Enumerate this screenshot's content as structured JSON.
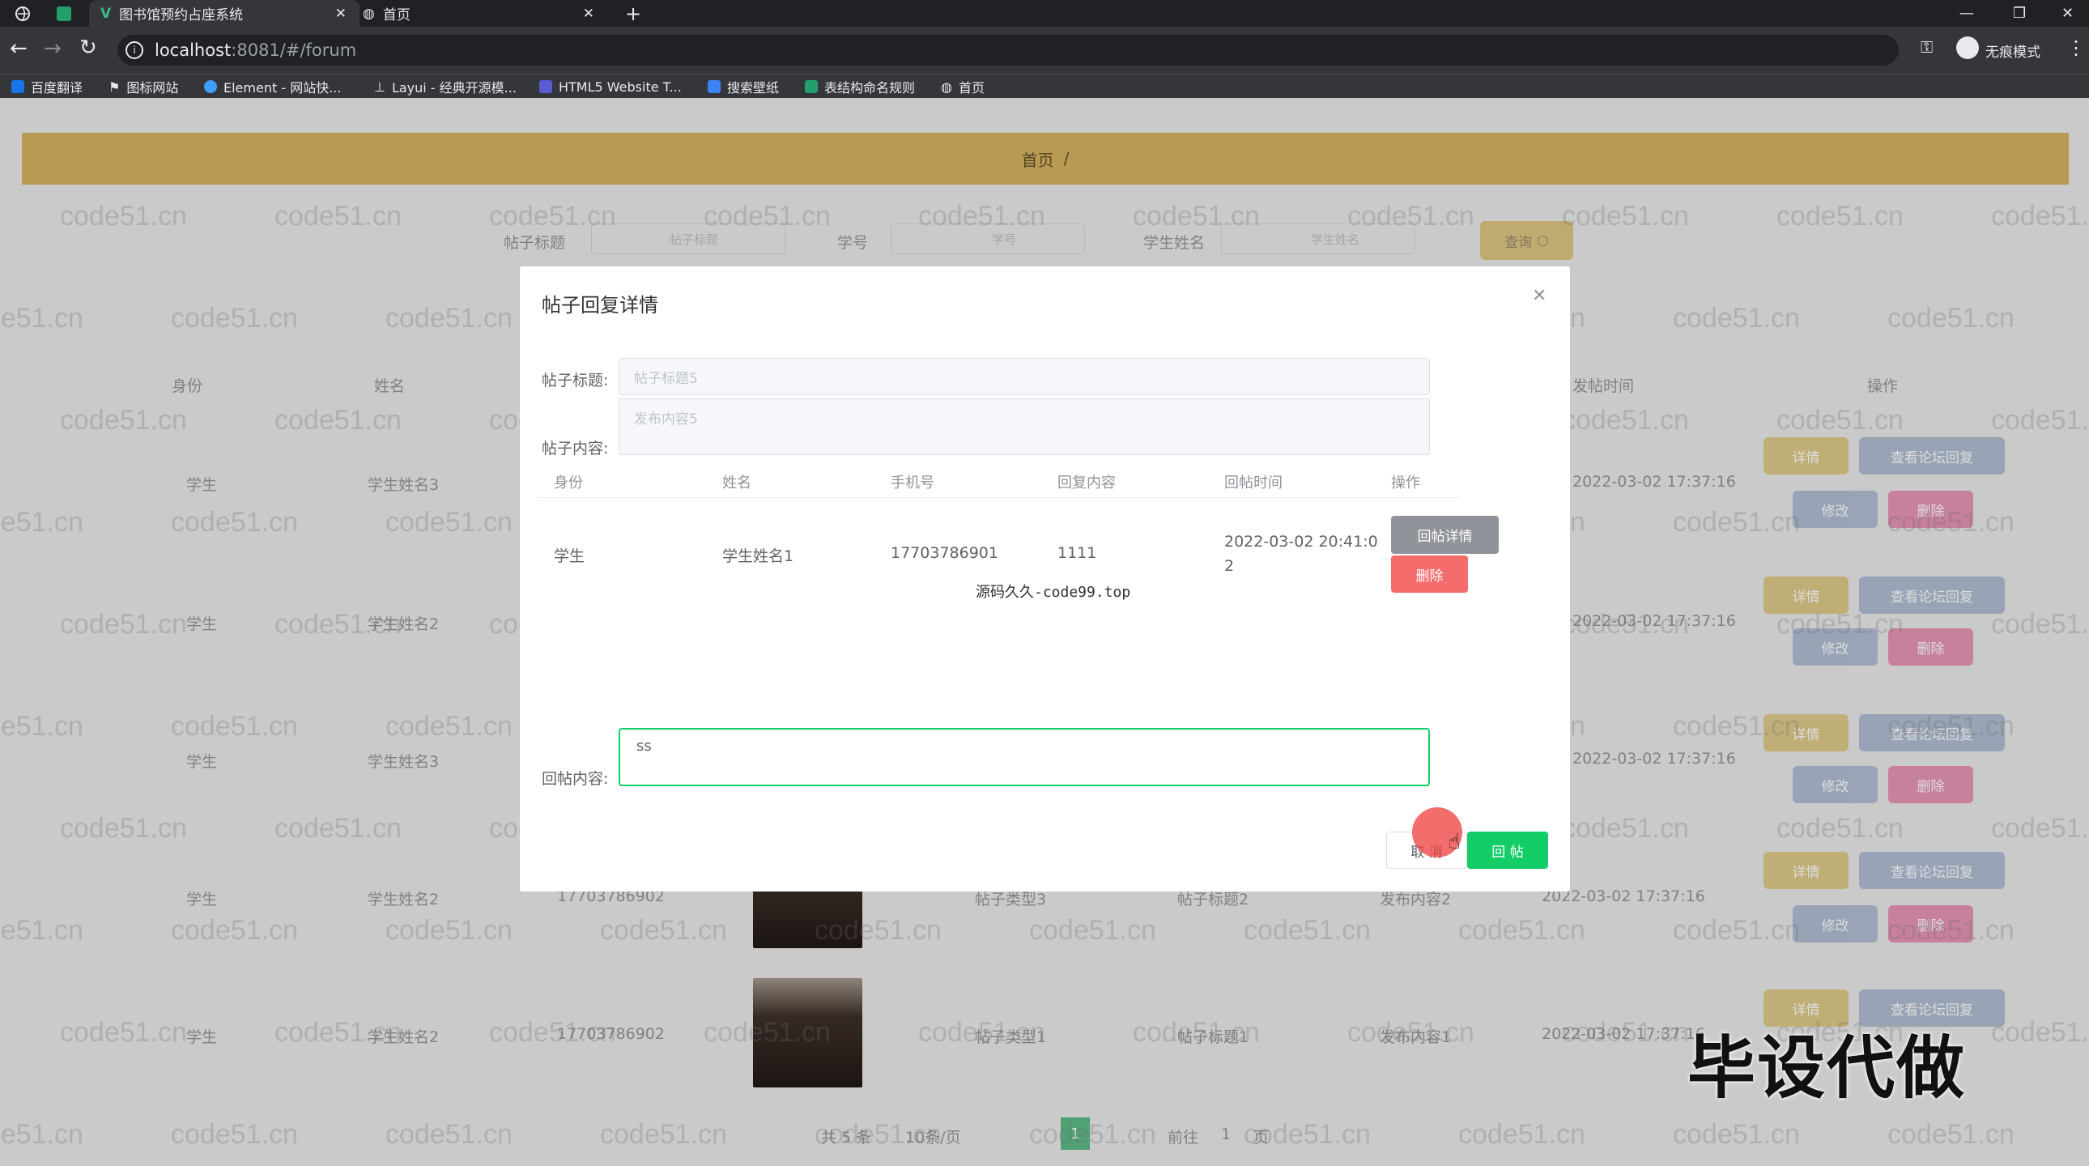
{
  "browser": {
    "tabs": [
      {
        "label": "图书馆预约占座系统"
      },
      {
        "label": "首页"
      }
    ],
    "url_host": "localhost",
    "url_rest": ":8081/#/forum",
    "profile_label": "无痕模式",
    "bookmarks": [
      {
        "label": "百度翻译",
        "color": "#1a73e8"
      },
      {
        "label": "图标网站",
        "color": "#e8eaed"
      },
      {
        "label": "Element - 网站快...",
        "color": "#409eff"
      },
      {
        "label": "Layui - 经典开源模...",
        "color": "#e8eaed"
      },
      {
        "label": "HTML5 Website T...",
        "color": "#5b5bd6"
      },
      {
        "label": "搜索壁纸",
        "color": "#3b82f6"
      },
      {
        "label": "表结构命名规则",
        "color": "#22a06b"
      },
      {
        "label": "首页",
        "color": "#e8eaed"
      }
    ]
  },
  "page": {
    "breadcrumb_home": "首页",
    "breadcrumb_sep": "/",
    "search": {
      "title_label": "帖子标题",
      "title_placeholder": "帖子标题",
      "id_label": "学号",
      "id_placeholder": "学号",
      "name_label": "学生姓名",
      "name_placeholder": "学生姓名",
      "query_button": "查询"
    },
    "columns": {
      "identity": "身份",
      "name": "姓名",
      "post_time": "发帖时间",
      "actions": "操作"
    },
    "rows": [
      {
        "identity": "学生",
        "name": "学生姓名3",
        "time": "2022-03-02 17:37:16"
      },
      {
        "identity": "学生",
        "name": "学生姓名2",
        "time": "2022-03-02 17:37:16"
      },
      {
        "identity": "学生",
        "name": "学生姓名3",
        "time": "2022-03-02 17:37:16"
      },
      {
        "identity": "学生",
        "name": "学生姓名2",
        "phone": "17703786902",
        "type": "帖子类型3",
        "title": "帖子标题2",
        "content": "发布内容2",
        "time": "2022-03-02 17:37:16"
      },
      {
        "identity": "学生",
        "name": "学生姓名2",
        "phone": "17703786902",
        "type": "帖子类型1",
        "title": "帖子标题1",
        "content": "发布内容1",
        "time": "2022-03-02 17:37:16"
      }
    ],
    "row_buttons": {
      "detail": "详情",
      "view_replies": "查看论坛回复",
      "edit": "修改",
      "delete": "删除"
    },
    "pagination": {
      "total": "共 5 条",
      "page_size": "10条/页",
      "current": "1",
      "goto": "前往",
      "goto_value": "1",
      "page_suffix": "页"
    }
  },
  "dialog": {
    "title": "帖子回复详情",
    "post_title_label": "帖子标题:",
    "post_title_placeholder": "帖子标题5",
    "post_content_label": "帖子内容:",
    "post_content_placeholder": "发布内容5",
    "table_headers": [
      "身份",
      "姓名",
      "手机号",
      "回复内容",
      "回帖时间",
      "操作"
    ],
    "reply_row": {
      "identity": "学生",
      "name": "学生姓名1",
      "phone": "17703786901",
      "content": "1111",
      "time_line1": "2022-03-02 20:41:0",
      "time_line2": "2"
    },
    "reply_detail_button": "回帖详情",
    "delete_button": "删除",
    "source_note": "源码久久-code99.top",
    "reply_label": "回帖内容:",
    "reply_value": "ss",
    "cancel_button": "取 消",
    "submit_button": "回 帖"
  },
  "watermark": "code51.cn",
  "overlay_caption": "毕设代做",
  "colors": {
    "accent": "#13ce66",
    "danger": "#f56c6c",
    "info": "#909399",
    "banner": "#c9a85a"
  }
}
